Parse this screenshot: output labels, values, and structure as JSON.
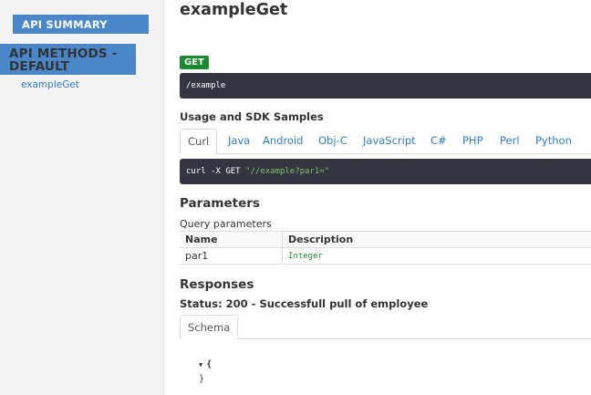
{
  "sidebar": {
    "api_summary": "API SUMMARY",
    "api_methods": "API METHODS - DEFAULT",
    "method_link": "exampleGet"
  },
  "main": {
    "title": "exampleGet",
    "method_badge": "GET",
    "path": "/example",
    "samples_heading": "Usage and SDK Samples",
    "tabs": [
      "Curl",
      "Java",
      "Android",
      "Obj-C",
      "JavaScript",
      "C#",
      "PHP",
      "Perl",
      "Python"
    ],
    "active_tab": "Curl",
    "curl_prefix": "curl -X GET ",
    "curl_url": "\"//example?par1=\"",
    "parameters_heading": "Parameters",
    "query_label": "Query parameters",
    "param_table": {
      "headers": [
        "Name",
        "Description"
      ],
      "rows": [
        {
          "name": "par1",
          "type": "Integer"
        }
      ]
    },
    "responses_heading": "Responses",
    "status_line": "Status: 200 - Successfull pull of employee",
    "schema_tab": "Schema",
    "schema_open": "{",
    "schema_close": "}",
    "caret_icon": "caret-down-icon"
  },
  "colors": {
    "accent": "#4a87c8",
    "link": "#2f7ec2",
    "get_badge": "#1a8a2f",
    "code_bg": "#333641",
    "string": "#7ec36b"
  }
}
